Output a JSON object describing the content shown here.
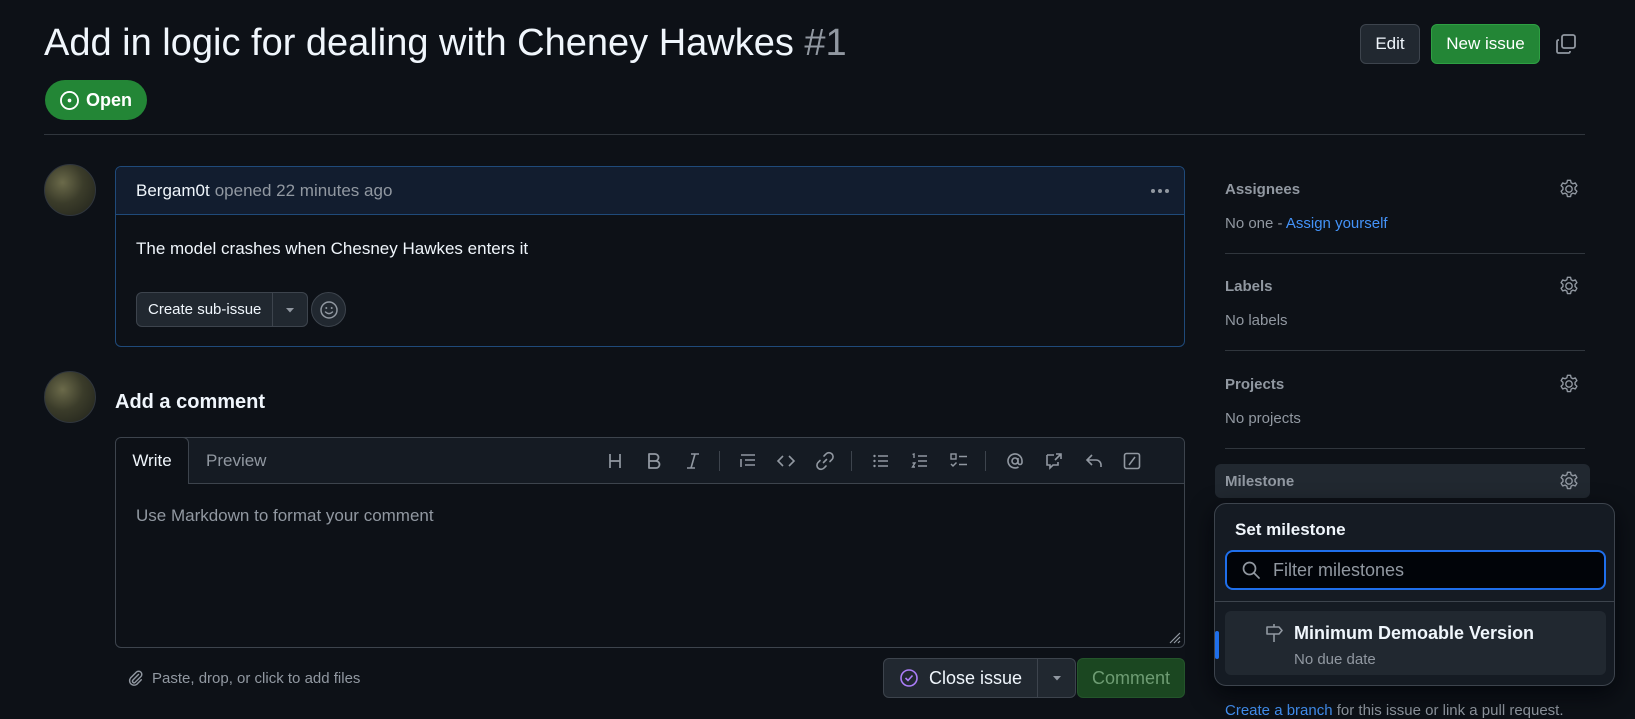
{
  "issue": {
    "title": "Add in logic for dealing with Cheney Hawkes",
    "number": "#1",
    "state": "Open"
  },
  "header": {
    "edit_label": "Edit",
    "new_issue_label": "New issue"
  },
  "comment": {
    "author": "Bergam0t",
    "meta": "opened 22 minutes ago",
    "body": "The model crashes when Chesney Hawkes enters it",
    "create_subissue_label": "Create sub-issue"
  },
  "new_comment": {
    "heading": "Add a comment",
    "tab_write": "Write",
    "tab_preview": "Preview",
    "placeholder": "Use Markdown to format your comment",
    "attach_text": "Paste, drop, or click to add files",
    "close_issue_label": "Close issue",
    "comment_label": "Comment"
  },
  "sidebar": {
    "assignees": {
      "label": "Assignees",
      "value_prefix": "No one - ",
      "link": "Assign yourself"
    },
    "labels": {
      "label": "Labels",
      "value": "No labels"
    },
    "projects": {
      "label": "Projects",
      "value": "No projects"
    },
    "milestone": {
      "label": "Milestone"
    },
    "footer_link": "Create a branch",
    "footer_text": " for this issue or link a pull request."
  },
  "milestone_popover": {
    "title": "Set milestone",
    "filter_placeholder": "Filter milestones",
    "items": [
      {
        "name": "Minimum Demoable Version",
        "due": "No due date"
      }
    ]
  },
  "colors": {
    "background": "#0d1117",
    "open_green": "#238636",
    "link_blue": "#4493f8",
    "muted": "#9198a1"
  }
}
